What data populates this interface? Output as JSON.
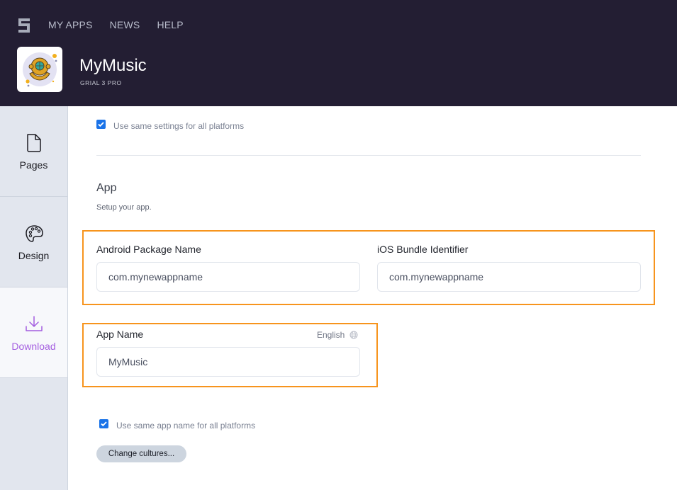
{
  "header": {
    "nav": [
      "MY APPS",
      "NEWS",
      "HELP"
    ],
    "app_title": "MyMusic",
    "app_subtitle": "GRIAL 3 PRO",
    "app_icon": "diving-helmet-icon"
  },
  "sidebar": {
    "items": [
      {
        "label": "Pages",
        "icon": "page-icon",
        "active": false
      },
      {
        "label": "Design",
        "icon": "palette-icon",
        "active": false
      },
      {
        "label": "Download",
        "icon": "download-icon",
        "active": true
      }
    ]
  },
  "main": {
    "same_settings_checkbox": {
      "label": "Use same settings for all platforms",
      "checked": true
    },
    "section_title": "App",
    "section_subtitle": "Setup your app.",
    "android_package": {
      "label": "Android Package Name",
      "value": "com.mynewappname"
    },
    "ios_bundle": {
      "label": "iOS Bundle Identifier",
      "value": "com.mynewappname"
    },
    "app_name": {
      "label": "App Name",
      "language": "English",
      "language_icon": "globe-icon",
      "value": "MyMusic"
    },
    "same_name_checkbox": {
      "label": "Use same app name for all platforms",
      "checked": true
    },
    "change_cultures_button": "Change cultures..."
  },
  "colors": {
    "header_bg": "#231e33",
    "highlight": "#f7941d",
    "active_accent": "#a45ee0",
    "checkbox": "#1a73e8"
  }
}
